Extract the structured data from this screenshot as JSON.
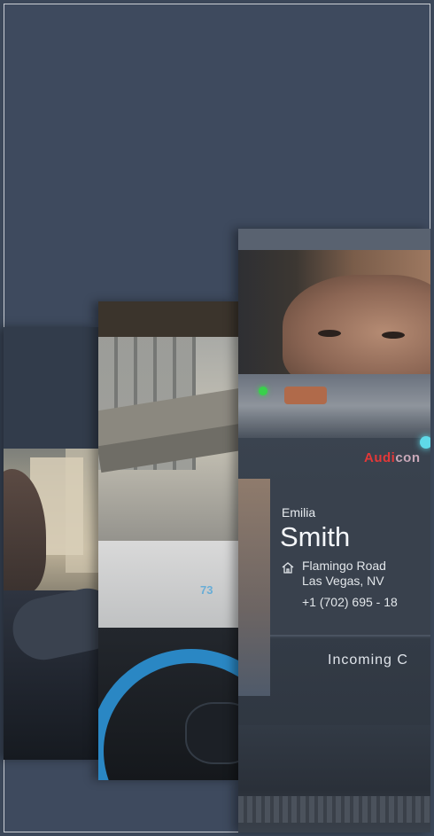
{
  "infotainment": {
    "brand_prefix": "Audi",
    "brand_suffix": "con",
    "caller": {
      "first_name": "Emilia",
      "last_name": "Smith",
      "address_line1": "Flamingo Road",
      "address_line2": "Las Vegas, NV",
      "phone": "+1 (702) 695 - 18"
    },
    "call_status": "Incoming C"
  },
  "hud": {
    "speed": "73"
  },
  "colors": {
    "background": "#3b4759",
    "accent_blue": "#2a87c4",
    "brand_red": "#e33838"
  }
}
